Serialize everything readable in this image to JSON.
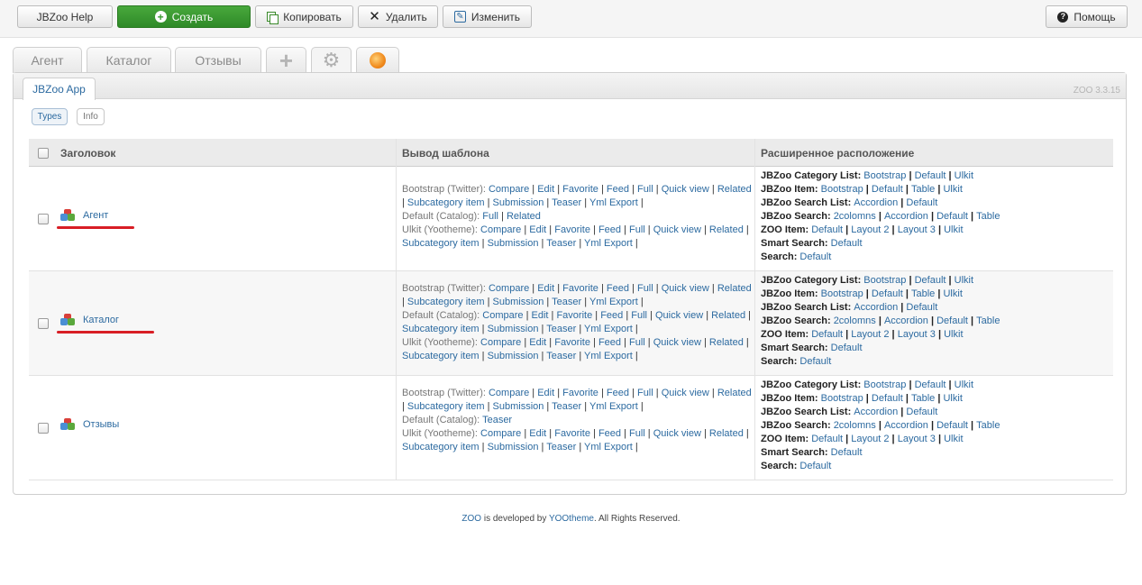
{
  "toolbar": {
    "help_label": "JBZoo Help",
    "create_label": "Создать",
    "copy_label": "Копировать",
    "delete_label": "Удалить",
    "edit_label": "Изменить",
    "assist_label": "Помощь"
  },
  "tabs": [
    {
      "label": "Агент"
    },
    {
      "label": "Каталог"
    },
    {
      "label": "Отзывы"
    },
    {
      "icon": "plus-icon"
    },
    {
      "icon": "gear-icon"
    },
    {
      "icon": "app-star-icon"
    }
  ],
  "panel": {
    "subtab": "JBZoo App",
    "version": "ZOO 3.3.15",
    "pills": [
      "Types",
      "Info"
    ]
  },
  "table": {
    "headers": [
      "Заголовок",
      "Вывод шаблона",
      "Расширенное расположение"
    ],
    "rows": [
      {
        "name": "Агент",
        "templates": [
          {
            "label": "Bootstrap (Twitter):",
            "items": [
              "Compare",
              "Edit",
              "Favorite",
              "Feed",
              "Full",
              "Quick view",
              "Related",
              "Subcategory item",
              "Submission",
              "Teaser",
              "Yml Export"
            ]
          },
          {
            "label": "Default (Catalog):",
            "items": [
              "Full",
              "Related"
            ]
          },
          {
            "label": "Ulkit (Yootheme):",
            "items": [
              "Compare",
              "Edit",
              "Favorite",
              "Feed",
              "Full",
              "Quick view",
              "Related",
              "Subcategory item",
              "Submission",
              "Teaser",
              "Yml Export"
            ]
          }
        ]
      },
      {
        "name": "Каталог",
        "templates": [
          {
            "label": "Bootstrap (Twitter):",
            "items": [
              "Compare",
              "Edit",
              "Favorite",
              "Feed",
              "Full",
              "Quick view",
              "Related",
              "Subcategory item",
              "Submission",
              "Teaser",
              "Yml Export"
            ]
          },
          {
            "label": "Default (Catalog):",
            "items": [
              "Compare",
              "Edit",
              "Favorite",
              "Feed",
              "Full",
              "Quick view",
              "Related",
              "Subcategory item",
              "Submission",
              "Teaser",
              "Yml Export"
            ]
          },
          {
            "label": "Ulkit (Yootheme):",
            "items": [
              "Compare",
              "Edit",
              "Favorite",
              "Feed",
              "Full",
              "Quick view",
              "Related",
              "Subcategory item",
              "Submission",
              "Teaser",
              "Yml Export"
            ]
          }
        ]
      },
      {
        "name": "Отзывы",
        "templates": [
          {
            "label": "Bootstrap (Twitter):",
            "items": [
              "Compare",
              "Edit",
              "Favorite",
              "Feed",
              "Full",
              "Quick view",
              "Related",
              "Subcategory item",
              "Submission",
              "Teaser",
              "Yml Export"
            ]
          },
          {
            "label": "Default (Catalog):",
            "items": [
              "Teaser"
            ]
          },
          {
            "label": "Ulkit (Yootheme):",
            "items": [
              "Compare",
              "Edit",
              "Favorite",
              "Feed",
              "Full",
              "Quick view",
              "Related",
              "Subcategory item",
              "Submission",
              "Teaser",
              "Yml Export"
            ]
          }
        ]
      }
    ],
    "extended": [
      {
        "label": "JBZoo Category List:",
        "items": [
          "Bootstrap",
          "Default",
          "Ulkit"
        ]
      },
      {
        "label": "JBZoo Item:",
        "items": [
          "Bootstrap",
          "Default",
          "Table",
          "Ulkit"
        ]
      },
      {
        "label": "JBZoo Search List:",
        "items": [
          "Accordion",
          "Default"
        ]
      },
      {
        "label": "JBZoo Search:",
        "items": [
          "2colomns",
          "Accordion",
          "Default",
          "Table"
        ]
      },
      {
        "label": "ZOO Item:",
        "items": [
          "Default",
          "Layout 2",
          "Layout 3",
          "Ulkit"
        ]
      },
      {
        "label": "Smart Search:",
        "items": [
          "Default"
        ]
      },
      {
        "label": "Search:",
        "items": [
          "Default"
        ]
      }
    ]
  },
  "footer": {
    "zoo": "ZOO",
    "middle": " is developed by ",
    "yootheme": "YOOtheme",
    "end": ". All Rights Reserved."
  }
}
